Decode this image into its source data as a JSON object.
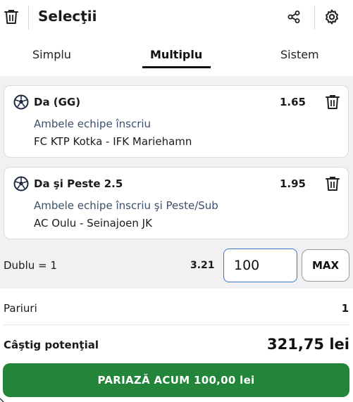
{
  "header": {
    "title": "Selecţii",
    "icons": {
      "delete_all": "trash-icon",
      "share": "share-icon",
      "settings": "gear-icon"
    }
  },
  "tabs": [
    {
      "label": "Simplu",
      "active": false
    },
    {
      "label": "Multiplu",
      "active": true
    },
    {
      "label": "Sistem",
      "active": false
    }
  ],
  "selections": [
    {
      "name": "Da (GG)",
      "odd": "1.65",
      "market": "Ambele echipe înscriu",
      "event": "FC KTP Kotka - IFK Mariehamn",
      "icon": "soccer-ball-icon"
    },
    {
      "name": "Da şi Peste 2.5",
      "odd": "1.95",
      "market": "Ambele echipe înscriu şi Peste/Sub",
      "event": "AC Oulu - Seinajoen JK",
      "icon": "soccer-ball-icon"
    }
  ],
  "stake": {
    "combo_label": "Dublu = 1",
    "total_odd": "3.21",
    "value": "100",
    "max_label": "MAX"
  },
  "summary": {
    "bets_label": "Pariuri",
    "bets_value": "1",
    "potential_win_label": "Câştig potenţial",
    "potential_win_value": "321,75 lei"
  },
  "place_bet": {
    "label": "PARIAZĂ ACUM 100,00 lei"
  },
  "colors": {
    "accent_green": "#22853a",
    "input_border": "#3a75c4",
    "market_text": "#3c4f6b",
    "list_background": "#f1f1f3"
  }
}
